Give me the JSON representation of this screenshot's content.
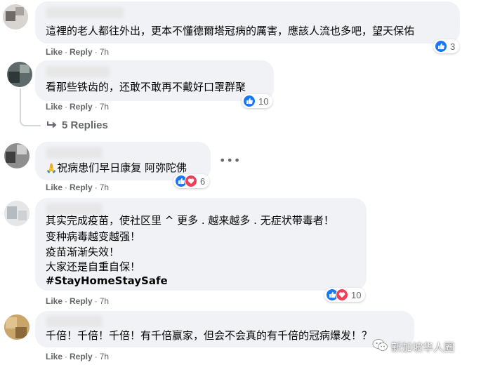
{
  "comments": [
    {
      "lines": [
        "這裡的老人都往外出，更本不懂德爾塔冠病的厲害，應該人流也多吧，望天保佑"
      ],
      "actions": {
        "like": "Like",
        "reply": "Reply",
        "time": "7h"
      },
      "reaction_count": "3"
    },
    {
      "lines": [
        "看那些铁齿的，还敢不敢再不戴好口罩群聚"
      ],
      "actions": {
        "like": "Like",
        "reply": "Reply",
        "time": "7h"
      },
      "reaction_count": "10",
      "replies_label": "5 Replies"
    },
    {
      "lines": [
        "祝病患们早日康复 阿弥陀佛"
      ],
      "emoji": "🙏",
      "actions": {
        "like": "Like",
        "reply": "Reply",
        "time": "7h"
      },
      "reaction_count": "6"
    },
    {
      "lines": [
        "其实完成疫苗，使社区里 ^ 更多 . 越来越多 . 无症状带毒者！",
        "变种病毒越变越强！",
        "疫苗渐渐失效！",
        "大家还是自重自保！"
      ],
      "hashtag": "#StayHomeStaySafe",
      "actions": {
        "like": "Like",
        "reply": "Reply",
        "time": "7h"
      },
      "reaction_count": "10"
    },
    {
      "lines": [
        "千倍！千倍！千倍！有千倍赢家，但会不会真的有千倍的冠病爆发！？"
      ],
      "actions": {
        "like": "Like",
        "reply": "Reply",
        "time": "7h"
      }
    }
  ],
  "more_options": "•••",
  "watermark": {
    "text": "新加坡华人圈"
  },
  "icons": {
    "like": "thumbs-up-icon",
    "love": "heart-icon",
    "replies": "reply-arrow-icon",
    "more": "more-options-icon"
  },
  "colors": {
    "bubble": "#f0f2f5",
    "like_blue": "#1877f2",
    "love_red": "#f33e58",
    "meta_gray": "#65676b"
  }
}
